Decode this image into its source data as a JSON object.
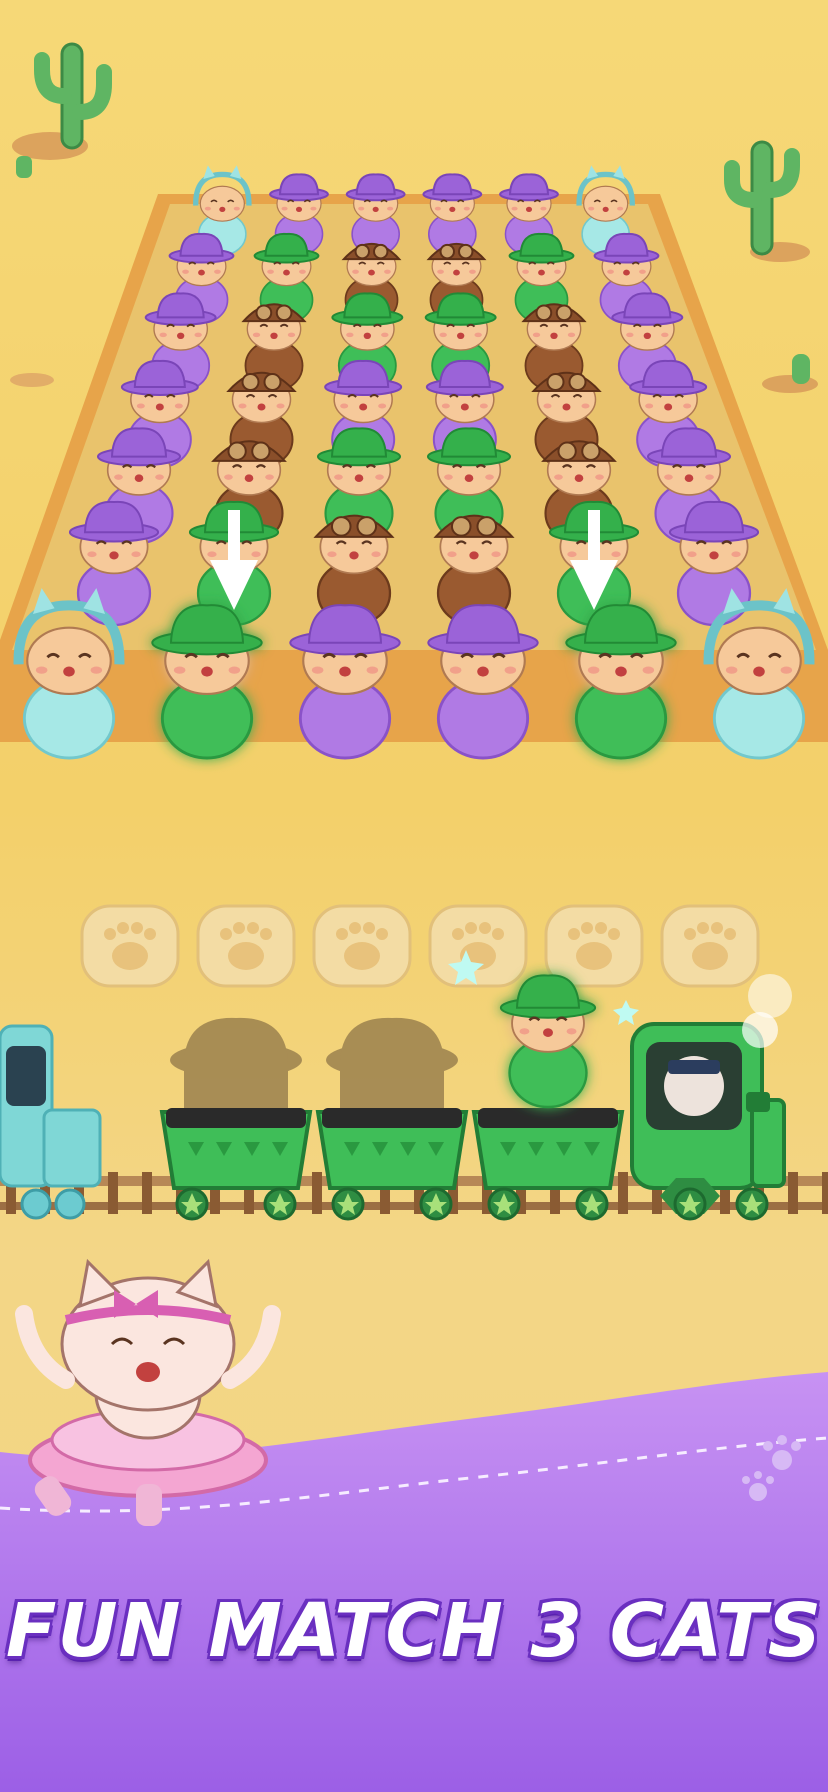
{
  "tagline": "FUN MATCH 3 CATS",
  "palette": {
    "sand": "#f3d06a",
    "board_border": "#e7a44a",
    "board_fill": "#e9c36c",
    "purple_band": "#b880ee",
    "fur": "#f6c99a",
    "glow": "#39e6d8"
  },
  "board_rows": [
    [
      "cyan",
      "purple",
      "purple",
      "purple",
      "purple",
      "cyan"
    ],
    [
      "purple",
      "green",
      "brown",
      "brown",
      "green",
      "purple"
    ],
    [
      "purple",
      "brown",
      "green",
      "green",
      "brown",
      "purple"
    ],
    [
      "purple",
      "brown",
      "purple",
      "purple",
      "brown",
      "purple"
    ],
    [
      "purple",
      "brown",
      "green",
      "green",
      "brown",
      "purple"
    ],
    [
      "purple",
      "green",
      "brown",
      "brown",
      "green",
      "purple"
    ],
    [
      "cyan",
      "green",
      "purple",
      "purple",
      "green",
      "cyan"
    ]
  ],
  "highlighted": [
    [
      6,
      1
    ],
    [
      6,
      4
    ]
  ],
  "down_arrows": [
    1,
    4
  ],
  "paw_slots": 6,
  "train": {
    "cart_contents": [
      "silhouette",
      "silhouette",
      "green-cat-jumping"
    ],
    "engine_color": "green",
    "left_engine_color": "cyan"
  },
  "mascot": "ballerina-cat"
}
